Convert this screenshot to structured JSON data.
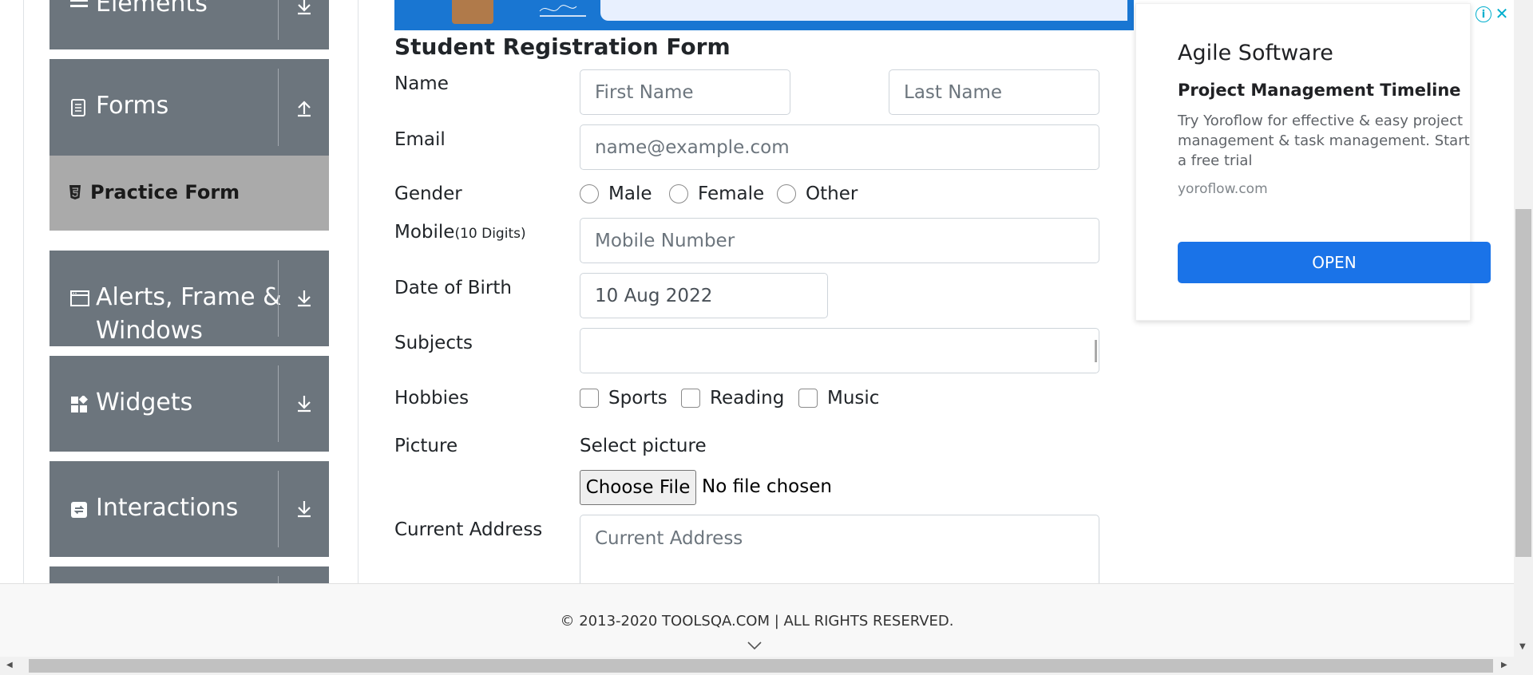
{
  "sidebar": {
    "groups": [
      {
        "label": "Elements",
        "icon": "hamburger-icon"
      },
      {
        "label": "Forms",
        "icon": "document-icon"
      },
      {
        "label": "Alerts, Frame & Windows",
        "label_line1": "Alerts, Frame &",
        "label_line2": "Windows",
        "icon": "window-icon"
      },
      {
        "label": "Widgets",
        "icon": "widgets-icon"
      },
      {
        "label": "Interactions",
        "icon": "interactions-icon"
      }
    ],
    "active_item": {
      "label": "Practice Form",
      "icon": "html5-icon"
    }
  },
  "form": {
    "title": "Student Registration Form",
    "name_label": "Name",
    "first_name_placeholder": "First Name",
    "last_name_placeholder": "Last Name",
    "email_label": "Email",
    "email_placeholder": "name@example.com",
    "gender_label": "Gender",
    "gender_options": [
      "Male",
      "Female",
      "Other"
    ],
    "mobile_label": "Mobile",
    "mobile_hint": "(10 Digits)",
    "mobile_placeholder": "Mobile Number",
    "dob_label": "Date of Birth",
    "dob_value": "10 Aug 2022",
    "subjects_label": "Subjects",
    "hobbies_label": "Hobbies",
    "hobbies_options": [
      "Sports",
      "Reading",
      "Music"
    ],
    "picture_label": "Picture",
    "select_picture": "Select picture",
    "choose_file": "Choose File",
    "no_file": "No file chosen",
    "address_label": "Current Address",
    "address_placeholder": "Current Address"
  },
  "ad": {
    "title": "Agile Software",
    "subtitle": "Project Management Timeline",
    "body": "Try Yoroflow for effective & easy project management & task management. Start a free trial",
    "url": "yoroflow.com",
    "button": "OPEN",
    "info": "i",
    "close": "✕"
  },
  "footer": {
    "text": "© 2013-2020 TOOLSQA.COM | ALL RIGHTS RESERVED."
  },
  "colors": {
    "sidebar_group": "#6c757d",
    "active_item": "#aaaaaa",
    "ad_button": "#1a73e8",
    "banner": "#1976d2"
  }
}
